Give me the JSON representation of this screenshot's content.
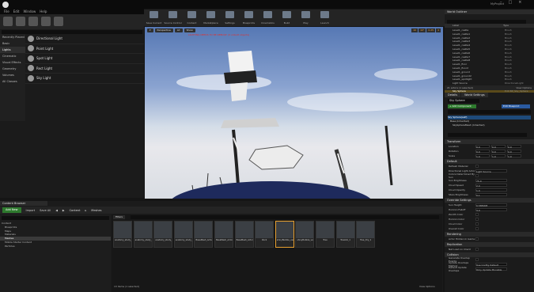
{
  "app": {
    "project_name": "MyProject",
    "menu": [
      "File",
      "Edit",
      "Window",
      "Help"
    ]
  },
  "modes": {
    "search_placeholder": "",
    "categories": [
      "Recently Placed",
      "Basic",
      "Lights",
      "Cinematic",
      "Visual Effects",
      "Geometry",
      "Volumes",
      "All Classes"
    ],
    "selected_category": "Lights",
    "items": [
      "Directional Light",
      "Point Light",
      "Spot Light",
      "Rect Light",
      "Sky Light"
    ]
  },
  "toolbar": [
    "Save Current",
    "Source Control",
    "Content",
    "Marketplace",
    "Settings",
    "Blueprints",
    "Cinematics",
    "Build",
    "Play",
    "Launch"
  ],
  "viewport": {
    "buttons": [
      "Perspective",
      "Lit",
      "Show"
    ],
    "info_text": "LIGHTING NEEDS TO BE REBUILT (3 unbuilt objects)",
    "right_controls": [
      "10",
      "10°",
      "0.25",
      "4"
    ]
  },
  "outliner": {
    "tab": "World Outliner",
    "col_label": "Label",
    "col_type": "Type",
    "rows": [
      {
        "name": "Level1_castle",
        "type": "Brush"
      },
      {
        "name": "Level1_castle1",
        "type": "Brush"
      },
      {
        "name": "Level1_castle2",
        "type": "Brush"
      },
      {
        "name": "Level1_castle3",
        "type": "Brush"
      },
      {
        "name": "Level1_castle4",
        "type": "Brush"
      },
      {
        "name": "Level1_castle5",
        "type": "Brush"
      },
      {
        "name": "Level1_castle6",
        "type": "Brush"
      },
      {
        "name": "Level1_castle7",
        "type": "Brush"
      },
      {
        "name": "Level1_castle8",
        "type": "Brush"
      },
      {
        "name": "Level1_floor",
        "type": "Brush"
      },
      {
        "name": "Level1_floor2",
        "type": "Brush"
      },
      {
        "name": "Level1_ground",
        "type": "Brush"
      },
      {
        "name": "Level1_ground2",
        "type": "Brush"
      },
      {
        "name": "Level1_spotlight",
        "type": "Brush"
      },
      {
        "name": "Light Source",
        "type": "DirectionalLight"
      },
      {
        "name": "PlayerStart",
        "type": "PlayerStart"
      },
      {
        "name": "Sky Sphere",
        "type": "Edit BP_Sky_Sphere"
      }
    ],
    "selected": "Sky Sphere",
    "footer": "21 actors (1 selected)",
    "view_options": "View Options"
  },
  "details": {
    "tabs": [
      "Details",
      "World Settings"
    ],
    "actor_name": "Sky Sphere",
    "add_component": "+ Add Component",
    "edit_blueprint": "Edit Blueprint",
    "components": [
      "Sky Sphere(self)",
      "Base (Inherited)",
      "SkySphereMesh (Inherited)"
    ],
    "sections": {
      "transform": "Transform",
      "default": "Default",
      "override_settings": "Override Settings",
      "rendering": "Rendering",
      "replication": "Replication",
      "collision": "Collision"
    },
    "transform_rows": [
      {
        "label": "Location",
        "values": [
          "0.0",
          "0.0",
          "0.0"
        ]
      },
      {
        "label": "Rotation",
        "values": [
          "0.0",
          "0.0",
          "0.0"
        ]
      },
      {
        "label": "Scale",
        "values": [
          "1.0",
          "1.0",
          "1.0"
        ]
      }
    ],
    "default_rows": [
      {
        "label": "Refresh Material",
        "value": ""
      },
      {
        "label": "Directional Light Actor",
        "value": "Light Source"
      },
      {
        "label": "Colors Determined By Sun",
        "value": ""
      },
      {
        "label": "Sun Brightness",
        "value": "75.0"
      },
      {
        "label": "Cloud Speed",
        "value": "2.0"
      },
      {
        "label": "Cloud Opacity",
        "value": "1.0"
      },
      {
        "label": "Stars Brightness",
        "value": "0.1"
      }
    ],
    "override_rows": [
      {
        "label": "Sun Height",
        "value": "0.588008"
      },
      {
        "label": "Horizon Falloff",
        "value": "3.0"
      },
      {
        "label": "Zenith Color",
        "value": ""
      },
      {
        "label": "Horizon Color",
        "value": ""
      },
      {
        "label": "Cloud Color",
        "value": ""
      },
      {
        "label": "Overall Color",
        "value": ""
      }
    ],
    "rendering_rows": [
      {
        "label": "Actor Hidden In Game",
        "value": ""
      }
    ],
    "replication_rows": [
      {
        "label": "Net Load on Client",
        "value": ""
      }
    ],
    "collision_rows": [
      {
        "label": "Generate Overlap Events",
        "value": ""
      },
      {
        "label": "Update Overlaps Method",
        "value": "Use Config Default"
      },
      {
        "label": "Default Update Overlaps",
        "value": "Only Update Movable"
      }
    ]
  },
  "content_browser": {
    "tab": "Content Browser",
    "add_new": "Add New",
    "import": "Import",
    "save_all": "Save All",
    "breadcrumb": [
      "Content",
      "Meshes"
    ],
    "folders": [
      "Content",
      "Blueprints",
      "Maps",
      "Materials",
      "Meshes",
      "Mobile Starter Content",
      "Particles"
    ],
    "selected_folder": "Meshes",
    "filters": "Filters",
    "assets": [
      "anatomy_study_body_07_body",
      "anatomy_study_body_07_bottoms",
      "anatomy_study_body_07_bottoms2",
      "anatomy_study_body_07_tops",
      "BasaMesh_Actor",
      "BasaMesh_Actor_PhysicsAsset",
      "BasaMesh_Actor_Skeleton",
      "Rock",
      "shinyBubble_vase_1_low_1",
      "shinyBubble_vase_1_lowmat",
      "Tree",
      "TreeGlx_1",
      "Tree_Dry_1"
    ],
    "selected_asset": "shinyBubble_vase_1_low_1",
    "status": "13 items (1 selected)",
    "view_options": "View Options"
  }
}
